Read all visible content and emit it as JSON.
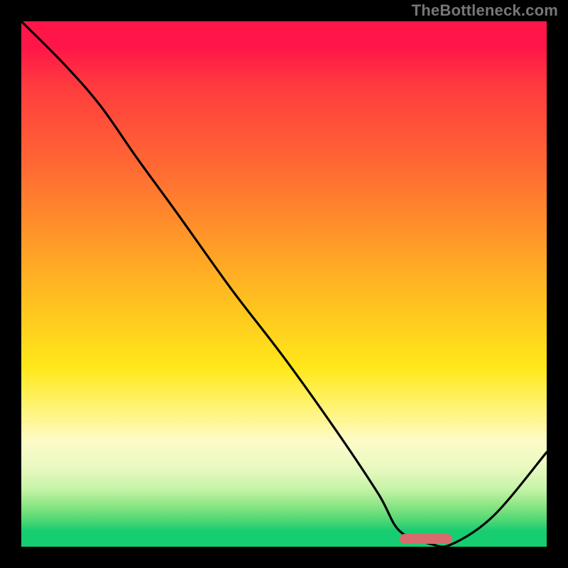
{
  "watermark": "TheBottleneck.com",
  "colors": {
    "frame": "#000000",
    "line": "#000000",
    "marker": "#d86b6d",
    "gradient_top": "#ff1648",
    "gradient_bottom": "#17cd71"
  },
  "chart_data": {
    "type": "line",
    "title": "",
    "xlabel": "",
    "ylabel": "",
    "xlim": [
      0,
      100
    ],
    "ylim": [
      0,
      100
    ],
    "x": [
      0,
      8,
      15,
      22,
      30,
      40,
      50,
      60,
      68,
      72,
      78,
      82,
      90,
      100
    ],
    "values": [
      100,
      92,
      84,
      74,
      63,
      49,
      36,
      22,
      10,
      3,
      0.5,
      0.5,
      6,
      18
    ],
    "series": [
      {
        "name": "bottleneck-curve",
        "x": [
          0,
          8,
          15,
          22,
          30,
          40,
          50,
          60,
          68,
          72,
          78,
          82,
          90,
          100
        ],
        "values": [
          100,
          92,
          84,
          74,
          63,
          49,
          36,
          22,
          10,
          3,
          0.5,
          0.5,
          6,
          18
        ]
      }
    ],
    "annotations": [
      {
        "type": "marker",
        "x_start": 72,
        "x_end": 82,
        "y": 1.5
      }
    ]
  }
}
